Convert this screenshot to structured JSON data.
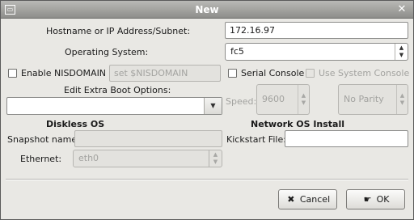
{
  "window": {
    "title": "New",
    "close_glyph": "✕",
    "menu_glyph": "▭"
  },
  "host": {
    "label": "Hostname or IP Address/Subnet:",
    "value": "172.16.97"
  },
  "os": {
    "label": "Operating System:",
    "value": "fc5"
  },
  "nisdomain": {
    "label": "Enable NISDOMAIN",
    "checked": false,
    "placeholder_value": "set $NISDOMAIN"
  },
  "serial": {
    "label": "Serial Console",
    "checked": false,
    "use_system_label": "Use System Console",
    "speed_label": "Speed:",
    "speed_value": "9600",
    "parity_value": "No Parity"
  },
  "boot": {
    "label": "Edit Extra Boot Options:",
    "value": ""
  },
  "diskless": {
    "section_title": "Diskless OS",
    "snapshot_label": "Snapshot name:",
    "snapshot_value": "",
    "ethernet_label": "Ethernet:",
    "ethernet_value": "eth0"
  },
  "network_install": {
    "section_title": "Network OS Install",
    "kickstart_label": "Kickstart File:",
    "kickstart_value": ""
  },
  "buttons": {
    "cancel_label": "Cancel",
    "ok_label": "OK"
  },
  "icons": {
    "cancel_icon": "close-x-icon",
    "ok_icon": "ok-hand-icon"
  }
}
